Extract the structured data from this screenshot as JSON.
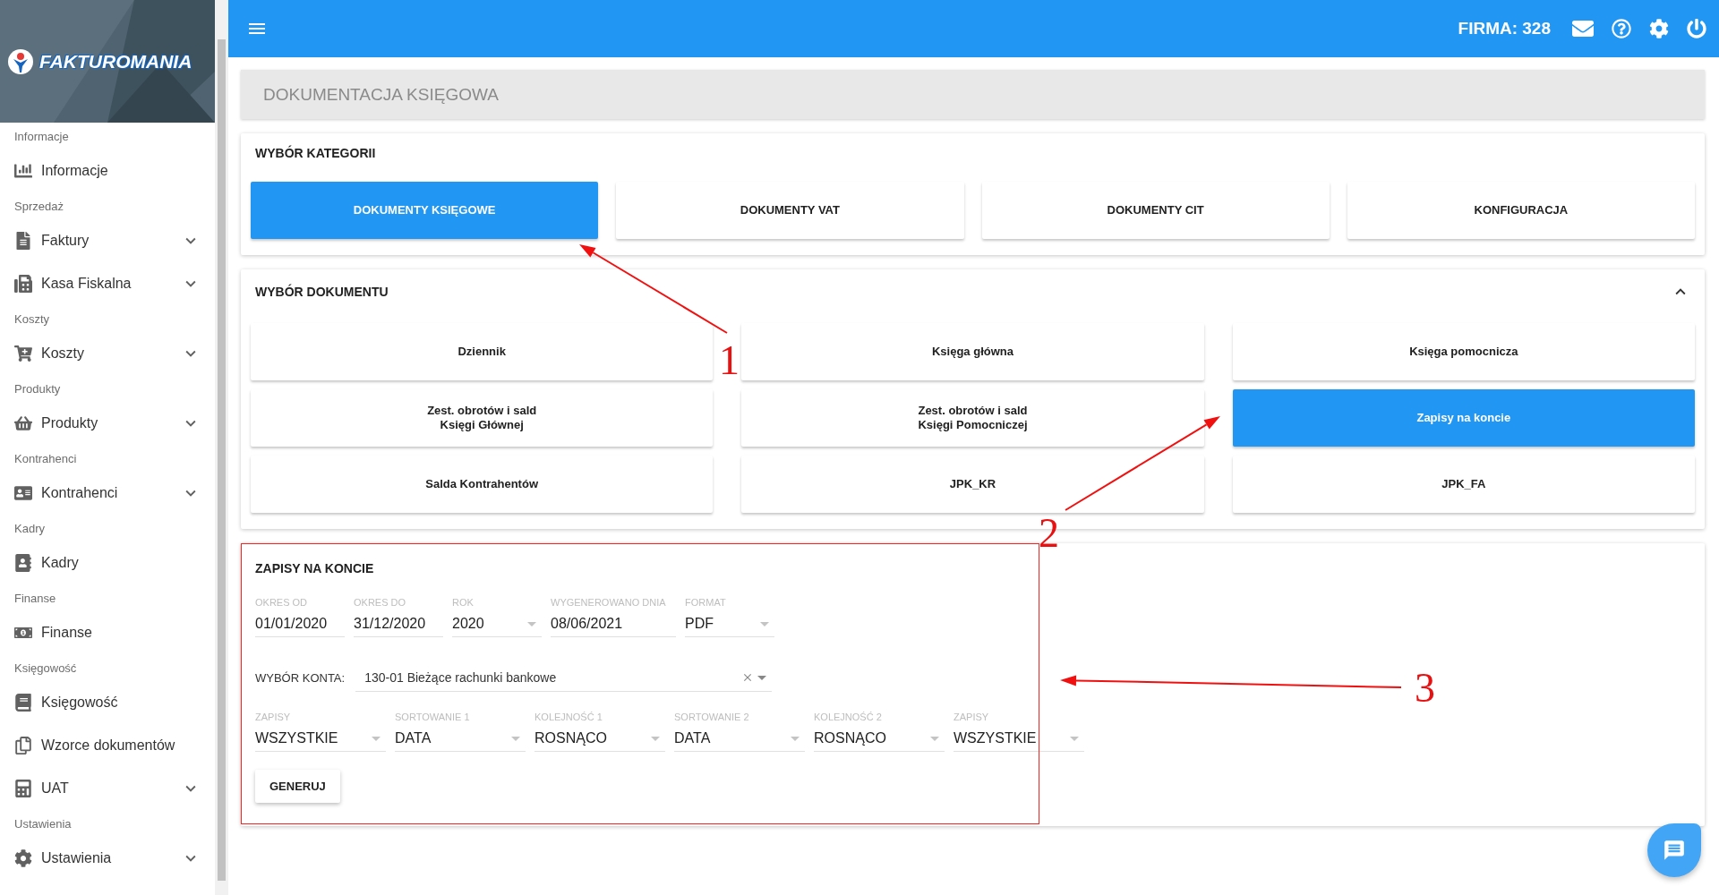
{
  "sidebar": {
    "logo": "FAKTUROMANIA",
    "sections": [
      {
        "title": "Informacje",
        "items": [
          {
            "label": "Informacje",
            "collapsible": false
          }
        ]
      },
      {
        "title": "Sprzedaż",
        "items": [
          {
            "label": "Faktury",
            "collapsible": true
          },
          {
            "label": "Kasa Fiskalna",
            "collapsible": true
          }
        ]
      },
      {
        "title": "Koszty",
        "items": [
          {
            "label": "Koszty",
            "collapsible": true
          }
        ]
      },
      {
        "title": "Produkty",
        "items": [
          {
            "label": "Produkty",
            "collapsible": true
          }
        ]
      },
      {
        "title": "Kontrahenci",
        "items": [
          {
            "label": "Kontrahenci",
            "collapsible": true
          }
        ]
      },
      {
        "title": "Kadry",
        "items": [
          {
            "label": "Kadry",
            "collapsible": false
          }
        ]
      },
      {
        "title": "Finanse",
        "items": [
          {
            "label": "Finanse",
            "collapsible": false
          }
        ]
      },
      {
        "title": "Księgowość",
        "items": [
          {
            "label": "Księgowość",
            "collapsible": false
          },
          {
            "label": "Wzorce dokumentów",
            "collapsible": false
          },
          {
            "label": "UAT",
            "collapsible": true
          }
        ]
      },
      {
        "title": "Ustawienia",
        "items": [
          {
            "label": "Ustawienia",
            "collapsible": true
          }
        ]
      }
    ]
  },
  "topbar": {
    "company": "FIRMA: 328"
  },
  "page_title": "DOKUMENTACJA KSIĘGOWA",
  "category_section": {
    "title": "WYBÓR KATEGORII",
    "buttons": [
      {
        "label": "DOKUMENTY KSIĘGOWE",
        "selected": true
      },
      {
        "label": "DOKUMENTY VAT",
        "selected": false
      },
      {
        "label": "DOKUMENTY CIT",
        "selected": false
      },
      {
        "label": "KONFIGURACJA",
        "selected": false
      }
    ]
  },
  "document_section": {
    "title": "WYBÓR DOKUMENTU",
    "expanded": true,
    "buttons": [
      {
        "label": "Dziennik",
        "selected": false
      },
      {
        "label": "Księga główna",
        "selected": false
      },
      {
        "label": "Księga pomocnicza",
        "selected": false
      },
      {
        "label": "Zest. obrotów i sald\nKsięgi Głównej",
        "selected": false
      },
      {
        "label": "Zest. obrotów i sald\nKsięgi Pomocniczej",
        "selected": false
      },
      {
        "label": "Zapisy na koncie",
        "selected": true
      },
      {
        "label": "Salda Kontrahentów",
        "selected": false
      },
      {
        "label": "JPK_KR",
        "selected": false
      },
      {
        "label": "JPK_FA",
        "selected": false
      }
    ]
  },
  "report": {
    "title": "ZAPISY NA KONCIE",
    "fields": [
      {
        "label": "OKRES OD",
        "value": "01/01/2020",
        "kind": "text"
      },
      {
        "label": "OKRES DO",
        "value": "31/12/2020",
        "kind": "text"
      },
      {
        "label": "ROK",
        "value": "2020",
        "kind": "select"
      },
      {
        "label": "WYGENEROWANO DNIA",
        "value": "08/06/2021",
        "kind": "text"
      },
      {
        "label": "FORMAT",
        "value": "PDF",
        "kind": "select"
      }
    ],
    "account": {
      "label": "WYBÓR KONTA:",
      "value": "130-01 Bieżące rachunki bankowe"
    },
    "options": [
      {
        "label": "ZAPISY",
        "value": "WSZYSTKIE"
      },
      {
        "label": "SORTOWANIE 1",
        "value": "DATA"
      },
      {
        "label": "KOLEJNOŚĆ 1",
        "value": "ROSNĄCO"
      },
      {
        "label": "SORTOWANIE 2",
        "value": "DATA"
      },
      {
        "label": "KOLEJNOŚĆ 2",
        "value": "ROSNĄCO"
      },
      {
        "label": "ZAPISY",
        "value": "WSZYSTKIE"
      }
    ],
    "button": "GENERUJ"
  },
  "annotations": [
    {
      "label": "1"
    },
    {
      "label": "2"
    },
    {
      "label": "3"
    }
  ]
}
